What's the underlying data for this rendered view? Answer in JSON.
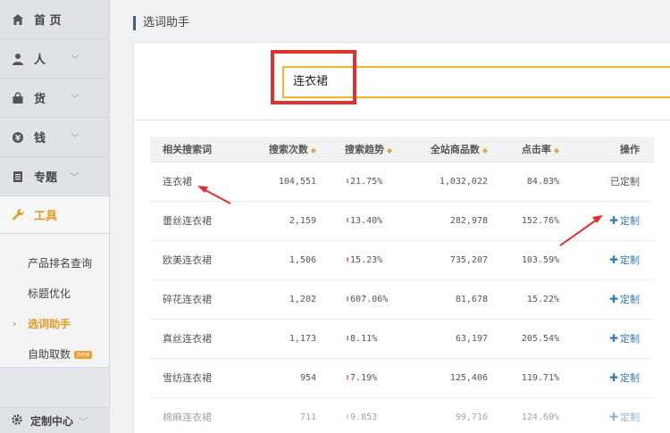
{
  "sidebar": {
    "items": [
      {
        "label": "首 页",
        "icon": "home-icon",
        "chevron": false
      },
      {
        "label": "人",
        "icon": "user-icon",
        "chevron": true
      },
      {
        "label": "货",
        "icon": "bag-icon",
        "chevron": true
      },
      {
        "label": "钱",
        "icon": "coin-icon",
        "chevron": true
      },
      {
        "label": "专题",
        "icon": "document-icon",
        "chevron": true
      }
    ],
    "active": {
      "label": "工具",
      "icon": "wrench-icon"
    },
    "submenu": [
      {
        "label": "产品排名查询"
      },
      {
        "label": "标题优化"
      },
      {
        "label": "选词助手",
        "current": true
      },
      {
        "label": "自助取数",
        "badge": "new"
      }
    ],
    "bottom": {
      "label": "定制中心",
      "icon": "gear-icon"
    }
  },
  "page": {
    "title": "选词助手"
  },
  "search": {
    "value": "连衣裙"
  },
  "table": {
    "headers": [
      "相关搜索词",
      "搜索次数",
      "搜索趋势",
      "全站商品数",
      "点击率",
      "操作"
    ],
    "rows": [
      {
        "keyword": "连衣裙",
        "searches": "104,551",
        "trend_dir": "down",
        "trend": "21.75%",
        "products": "1,032,022",
        "ctr": "84.83%",
        "action": "已定制",
        "customized": true
      },
      {
        "keyword": "蕾丝连衣裙",
        "searches": "2,159",
        "trend_dir": "down",
        "trend": "13.40%",
        "products": "282,978",
        "ctr": "152.76%",
        "action": "定制",
        "customized": false
      },
      {
        "keyword": "欧美连衣裙",
        "searches": "1,506",
        "trend_dir": "up",
        "trend": "15.23%",
        "products": "735,207",
        "ctr": "103.59%",
        "action": "定制",
        "customized": false
      },
      {
        "keyword": "碎花连衣裙",
        "searches": "1,202",
        "trend_dir": "up",
        "trend": "607.06%",
        "products": "81,678",
        "ctr": "15.22%",
        "action": "定制",
        "customized": false
      },
      {
        "keyword": "真丝连衣裙",
        "searches": "1,173",
        "trend_dir": "up",
        "trend": "8.11%",
        "products": "63,197",
        "ctr": "205.54%",
        "action": "定制",
        "customized": false
      },
      {
        "keyword": "雪纺连衣裙",
        "searches": "954",
        "trend_dir": "up",
        "trend": "7.19%",
        "products": "125,406",
        "ctr": "119.71%",
        "action": "定制",
        "customized": false
      },
      {
        "keyword": "棉麻连衣裙",
        "searches": "711",
        "trend_dir": "down",
        "trend": "9.853",
        "products": "99,716",
        "ctr": "124.60%",
        "action": "定制",
        "customized": false
      }
    ]
  },
  "colors": {
    "accent": "#e09b23",
    "search_border": "#f3b331",
    "highlight_red": "#e0322c",
    "link_blue": "#337ab7",
    "trend_up": "#d9534f",
    "trend_down": "#5aa847"
  }
}
